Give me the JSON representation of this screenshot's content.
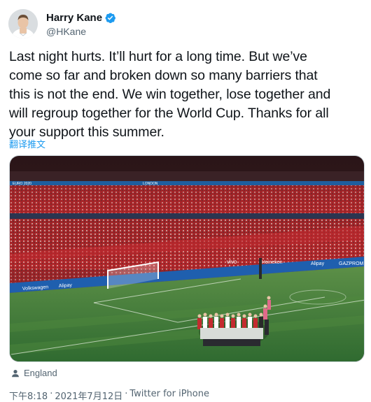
{
  "author": {
    "display_name": "Harry Kane",
    "handle": "@HKane",
    "verified_icon": "verified-badge-icon",
    "avatar_icon": "profile-avatar"
  },
  "tweet": {
    "text_lines": [
      "Last night hurts. It’ll hurt for a long time. But we’ve",
      "come so far and broken down so many barriers that",
      "this is not the end. We win together, lose together and",
      "will regroup together for the World Cup. Thanks for all",
      "your support this summer."
    ],
    "translate_label": "翻译推文"
  },
  "media": {
    "description_icon": "stadium-photo",
    "banner_texts": [
      "EURO 2020",
      "LONDON",
      "Volkswagen",
      "Alipay",
      "vivo",
      "Heineken",
      "Alipay",
      "GAZPROM"
    ]
  },
  "location": {
    "icon": "location-pin-icon",
    "label": "England"
  },
  "meta": {
    "time": "下午8:18",
    "date": "2021年7月12日",
    "separator": "·",
    "source": "Twitter for iPhone"
  },
  "colors": {
    "link": "#1d9bf0",
    "secondary_text": "#536471",
    "pitch": "#3f7a3a",
    "stand": "#b8272b"
  }
}
